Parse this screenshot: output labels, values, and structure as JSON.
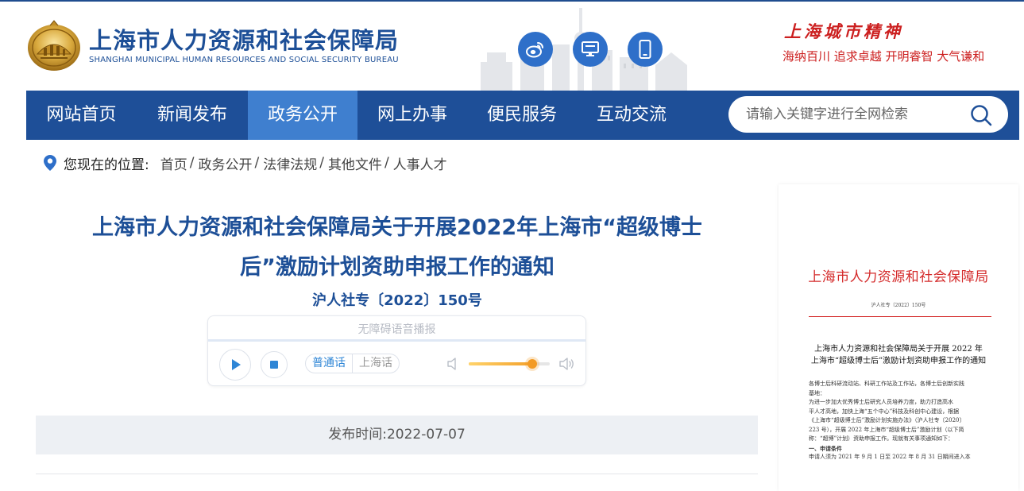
{
  "header": {
    "title_cn": "上海市人力资源和社会保障局",
    "title_en": "SHANGHAI MUNICIPAL HUMAN RESOURCES AND SOCIAL SECURITY BUREAU",
    "social_icons": [
      "weibo-icon",
      "desktop-icon",
      "mobile-icon"
    ],
    "spirit_title": "上海城市精神",
    "spirit_sub": "海纳百川  追求卓越  开明睿智  大气谦和"
  },
  "nav": {
    "items": [
      {
        "label": "网站首页"
      },
      {
        "label": "新闻发布"
      },
      {
        "label": "政务公开"
      },
      {
        "label": "网上办事"
      },
      {
        "label": "便民服务"
      },
      {
        "label": "互动交流"
      }
    ],
    "active_label": "政务公开",
    "search": {
      "placeholder": "请输入关键字进行全网检索",
      "value": ""
    }
  },
  "breadcrumb": {
    "label": "您现在的位置:",
    "items": [
      "首页",
      "政务公开",
      "法律法规",
      "其他文件",
      "人事人才"
    ],
    "separator": "/"
  },
  "article": {
    "title_line1": "上海市人力资源和社会保障局关于开展2022年上海市“超级博士",
    "title_line2": "后”激励计划资助申报工作的通知",
    "doc_number": "沪人社专〔2022〕150号",
    "publish_label": "发布时间:",
    "publish_date": "2022-07-07"
  },
  "player": {
    "label": "无障碍语音播报",
    "languages": [
      "普通话",
      "上海话"
    ],
    "active_language": "普通话",
    "volume": 0.78
  },
  "doc_preview": {
    "heading": "上海市人力资源和社会保障局",
    "number": "沪人社专〔2022〕150号",
    "title_line1": "上海市人力资源和社会保障局关于开展 2022 年",
    "title_line2": "上海市“超级博士后”激励计划资助申报工作的通知",
    "body": [
      "各博士后科研流动站、科研工作站及工作站，各博士后创新实践",
      "基地：",
      "    为进一步加大优秀博士后研究人员培养力度，助力打造高水",
      "平人才高地，加快上海“五个中心”科技及科创中心建设，根据",
      "《上海市“超级博士后”激励计划实施办法》（沪人社专〔2020〕",
      "223 号），开展 2022 年上海市“超级博士后”激励计划（以下简",
      "称：“超博”计划）资助申报工作。现就有关事项通知如下：",
      "    一、申请条件",
      "    申请人须为 2021 年 9 月 1 日至 2022 年 8 月 31 日期间进入本"
    ],
    "bold_line_index": 7,
    "colors": {
      "heading": "#d42a2a",
      "redline": "#d42a2a"
    }
  },
  "colors": {
    "brand_blue": "#1e4f98",
    "nav_active": "#3f7fcf",
    "title_blue": "#1d4f97",
    "spirit_red": "#cc1f1f",
    "volume_orange": "#f39b25"
  }
}
